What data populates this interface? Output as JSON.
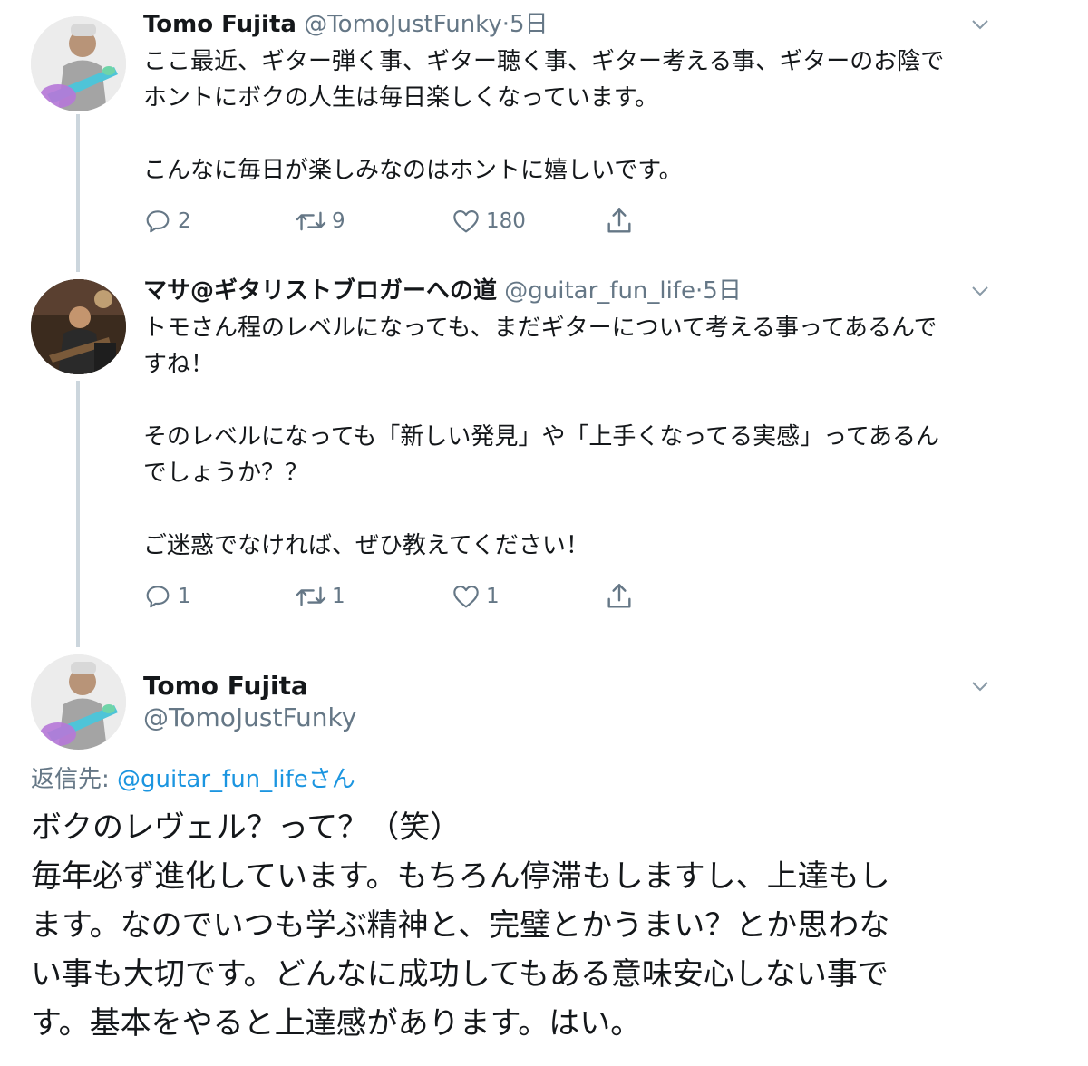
{
  "tweets": [
    {
      "name": "Tomo Fujita",
      "handle": "@TomoJustFunky",
      "separator": "·",
      "time": "5日",
      "text": "ここ最近、ギター弾く事、ギター聴く事、ギター考える事、ギターのお陰で\nホントにボクの人生は毎日楽しくなっています。\n\nこんなに毎日が楽しみなのはホントに嬉しいです。",
      "replies": "2",
      "retweets": "9",
      "likes": "180"
    },
    {
      "name": "マサ@ギタリストブロガーへの道",
      "handle": "@guitar_fun_life",
      "separator": "·",
      "time": "5日",
      "text": "トモさん程のレベルになっても、まだギターについて考える事ってあるんで\nすね！\n\nそのレベルになっても「新しい発見」や「上手くなってる実感」ってあるん\nでしょうか？？\n\nご迷惑でなければ、ぜひ教えてください！",
      "replies": "1",
      "retweets": "1",
      "likes": "1"
    }
  ],
  "main_tweet": {
    "name": "Tomo Fujita",
    "handle": "@TomoJustFunky",
    "reply_prefix": "返信先: ",
    "reply_handle": "@guitar_fun_lifeさん",
    "text": "ボクのレヴェル？って？（笑）\n毎年必ず進化しています。もちろん停滞もしますし、上達もし\nます。なのでいつも学ぶ精神と、完璧とかうまい？とか思わな\nい事も大切です。どんなに成功してもある意味安心しない事で\nす。基本をやると上達感があります。はい。"
  },
  "colors": {
    "text": "#14171a",
    "secondary": "#657786",
    "link": "#1b95e0",
    "thread_line": "#ccd6dd"
  }
}
